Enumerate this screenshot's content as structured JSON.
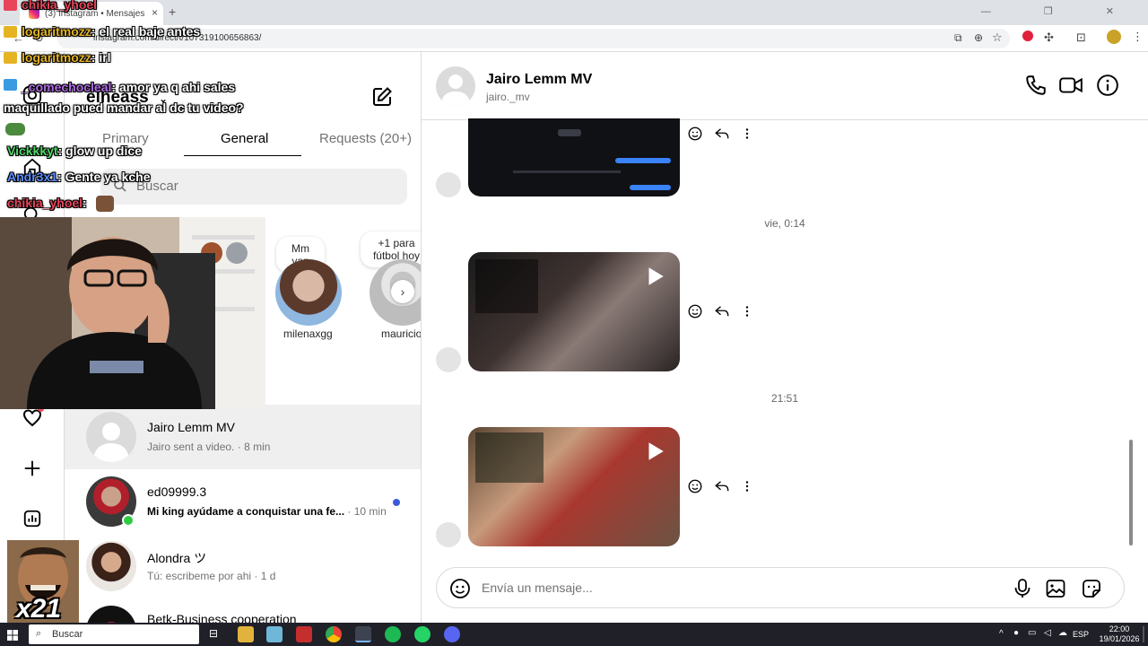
{
  "browser": {
    "tab_title": "(3) Instagram • Mensajes",
    "url": "instagram.com/direct/t/107319100656863/"
  },
  "inbox": {
    "username": "elheass",
    "tabs": [
      "Primary",
      "General",
      "Requests (20+)"
    ],
    "active_tab": "General",
    "search_placeholder": "Buscar",
    "notes": [
      {
        "text": "Mm yap",
        "name": "milenaxgg"
      },
      {
        "text": "+1 para fútbol hoy",
        "name": "mauricio"
      }
    ],
    "conversations": [
      {
        "name": "Jairo Lemm MV",
        "preview": "Jairo sent a video.",
        "time": "· 8 min",
        "unread": false,
        "active": true
      },
      {
        "name": "ed09999.3",
        "preview": "Mi king ayúdame a conquistar una fe...",
        "time": "· 10 min",
        "unread": true,
        "active": false
      },
      {
        "name": "Alondra ツ",
        "preview": "Tú: escribeme por ahi",
        "time": "· 1 d",
        "unread": false,
        "active": false
      },
      {
        "name": "Betk-Business cooperation",
        "preview": "",
        "time": "",
        "unread": false,
        "active": false
      }
    ]
  },
  "chat": {
    "contact_name": "Jairo Lemm MV",
    "contact_handle": "jairo._mv",
    "timestamps": [
      "vie, 0:14",
      "21:51"
    ],
    "composer_placeholder": "Envía un mensaje..."
  },
  "stream_overlay": {
    "messages": [
      {
        "user": "chikia_yhoel",
        "text": "",
        "color": "#e8455a"
      },
      {
        "user": "logaritmozz",
        "text": ": el real baje antes",
        "color": "#e6b422"
      },
      {
        "user": "logaritmozz",
        "text": ": irl",
        "color": "#e6b422"
      },
      {
        "user": "_comechocleal",
        "text": ": amor ya q ahi sales maquillado pued mandar al dc tu video?",
        "color": "#b26ce6"
      },
      {
        "user": "Vickkkyt",
        "text": ": glow up dice",
        "color": "#4cd964"
      },
      {
        "user": "Andr3x1",
        "text": ": Gente ya kche",
        "color": "#5a8cff"
      },
      {
        "user": "chikia_yhoel",
        "text": ":",
        "color": "#e8455a"
      }
    ],
    "meme_label": "x21"
  },
  "taskbar": {
    "search_label": "Buscar",
    "language": "ESP",
    "time": "22:00",
    "date": "19/01/2026"
  },
  "colors": {
    "unread_dot": "#3b5bdb",
    "online_dot": "#2ecc40",
    "notification_dot": "#ed4956"
  }
}
